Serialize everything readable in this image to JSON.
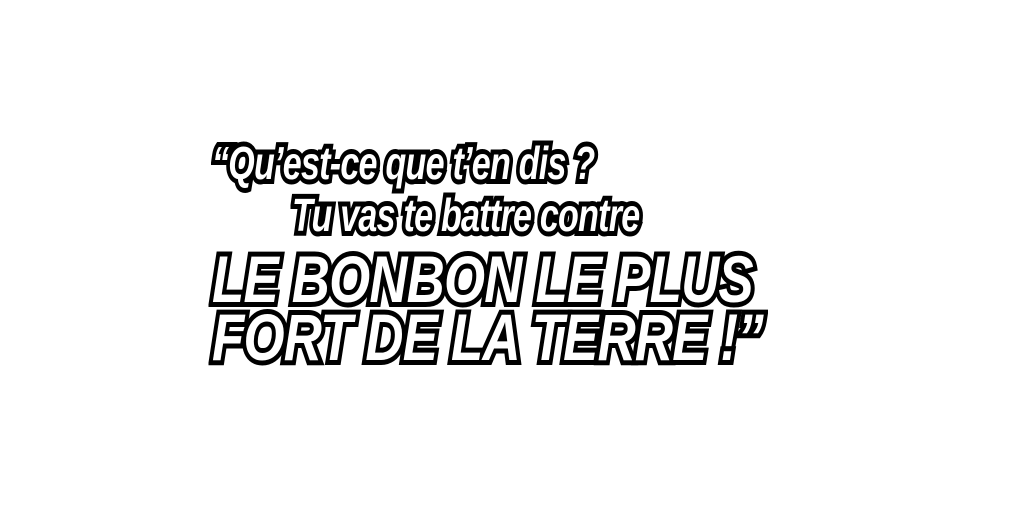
{
  "caption": {
    "line1": "“Qu’est-ce que t’en dis ?",
    "line2": "Tu vas te battre contre",
    "line3": "LE BONBON LE PLUS",
    "line4": "FORT DE LA TERRE !”"
  },
  "colors": {
    "background": "#ffffff",
    "text_fill": "#ffffff",
    "text_outline": "#000000"
  }
}
